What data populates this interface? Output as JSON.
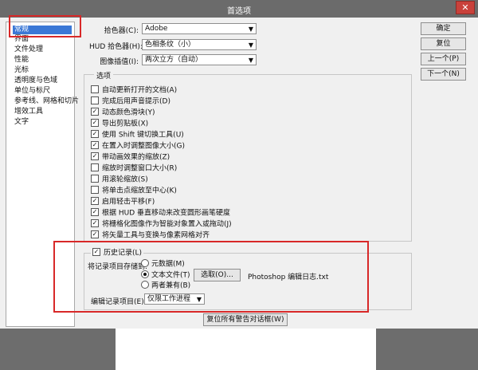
{
  "window": {
    "title": "首选项",
    "close_glyph": "✕"
  },
  "sidebar": {
    "items": [
      {
        "label": "常规",
        "selected": true
      },
      {
        "label": "界面"
      },
      {
        "label": "文件处理"
      },
      {
        "label": "性能"
      },
      {
        "label": "光标"
      },
      {
        "label": "透明度与色域"
      },
      {
        "label": "单位与标尺"
      },
      {
        "label": "参考线、网格和切片"
      },
      {
        "label": "增效工具"
      },
      {
        "label": "文字"
      }
    ]
  },
  "settings": {
    "color_picker": {
      "label": "拾色器(C):",
      "value": "Adobe"
    },
    "hud_picker": {
      "label": "HUD 拾色器(H):",
      "value": "色相条纹（小）"
    },
    "interpolation": {
      "label": "图像插值(I):",
      "value": "两次立方（自动）"
    }
  },
  "options": {
    "title": "选项",
    "items": [
      {
        "label": "自动更新打开的文档(A)",
        "checked": false
      },
      {
        "label": "完成后用声音提示(D)",
        "checked": false
      },
      {
        "label": "动态颜色滑块(Y)",
        "checked": true
      },
      {
        "label": "导出剪贴板(X)",
        "checked": true
      },
      {
        "label": "使用 Shift 键切换工具(U)",
        "checked": true
      },
      {
        "label": "在置入时调整图像大小(G)",
        "checked": true
      },
      {
        "label": "带动画效果的缩放(Z)",
        "checked": true
      },
      {
        "label": "缩放时调整窗口大小(R)",
        "checked": false
      },
      {
        "label": "用滚轮缩放(S)",
        "checked": false
      },
      {
        "label": "将单击点缩放至中心(K)",
        "checked": false
      },
      {
        "label": "启用轻击平移(F)",
        "checked": true
      },
      {
        "label": "根据 HUD 垂直移动来改变圆形画笔硬度",
        "checked": true
      },
      {
        "label": "将栅格化图像作为智能对象置入或拖动(J)",
        "checked": true
      },
      {
        "label": "将矢量工具与变换与像素网格对齐",
        "checked": true
      }
    ]
  },
  "history": {
    "enable_label": "历史记录(L)",
    "enabled": true,
    "save_to_label": "将记录项目存储到:",
    "radios": [
      {
        "label": "元数据(M)",
        "selected": false
      },
      {
        "label": "文本文件(T)",
        "selected": true
      },
      {
        "label": "两者兼有(B)",
        "selected": false
      }
    ],
    "choose_button": "选取(O)...",
    "file_name": "Photoshop 编辑日志.txt",
    "edit_log_label": "编辑记录项目(E):",
    "edit_log_value": "仅限工作进程"
  },
  "reset_warnings_button": "复位所有警告对话框(W)",
  "buttons": {
    "ok": "确定",
    "reset": "复位",
    "prev": "上一个(P)",
    "next": "下一个(N)"
  }
}
